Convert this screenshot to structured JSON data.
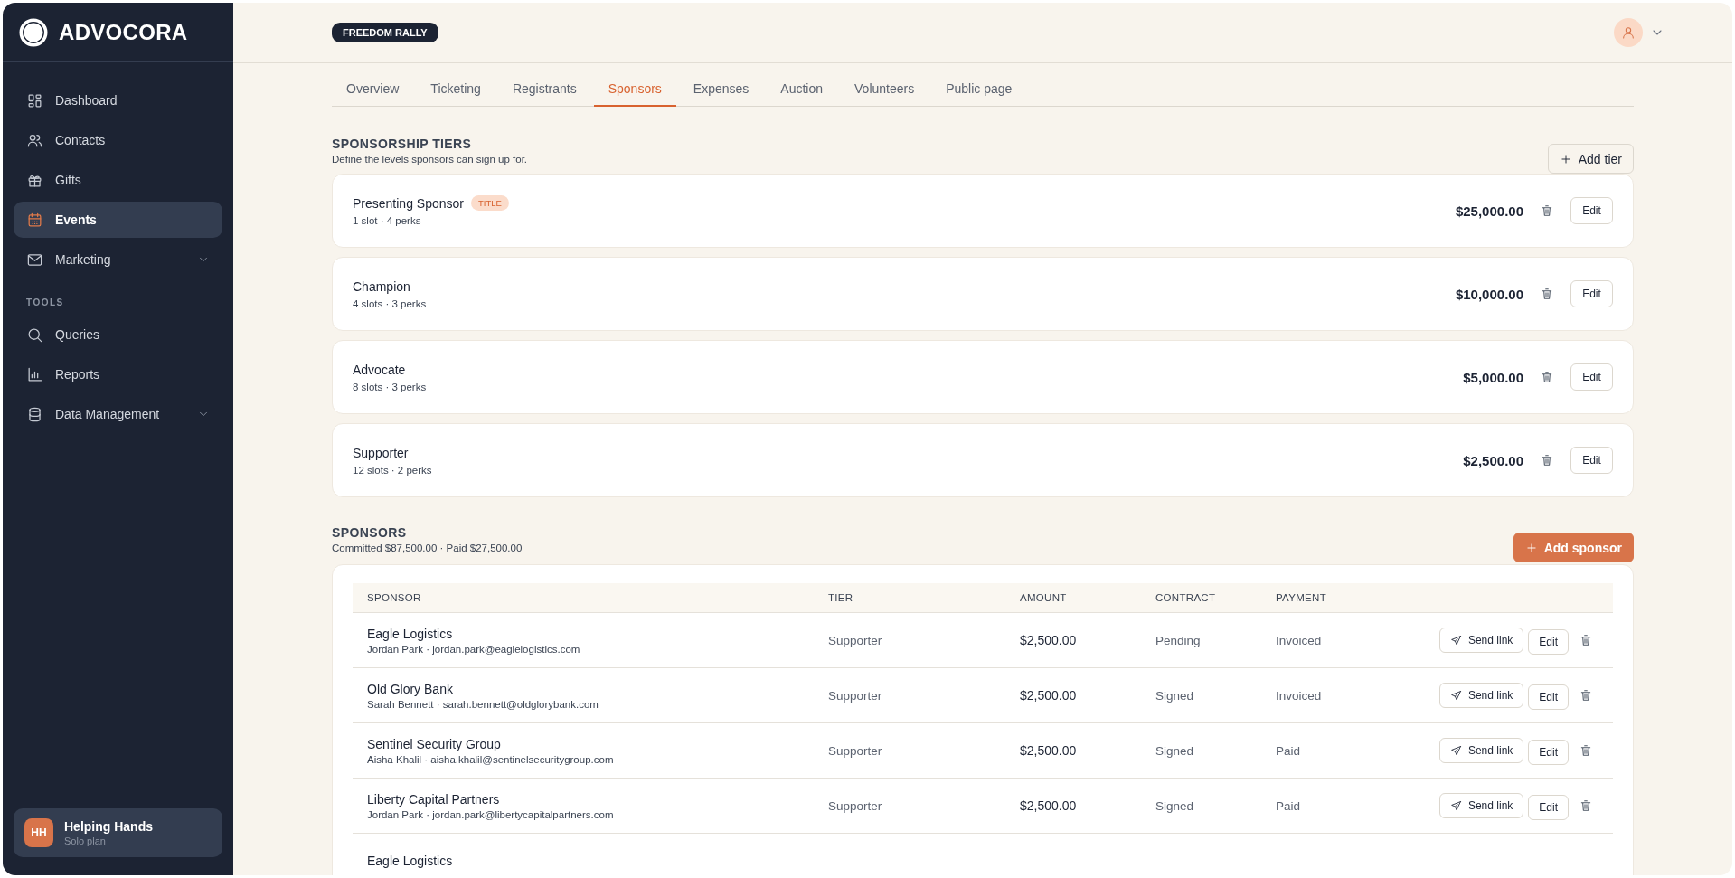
{
  "sidebar": {
    "brand": "ADVOCORA",
    "items": [
      {
        "label": "Dashboard",
        "selected": false,
        "expandable": false
      },
      {
        "label": "Contacts",
        "selected": false,
        "expandable": false
      },
      {
        "label": "Gifts",
        "selected": false,
        "expandable": false
      },
      {
        "label": "Events",
        "selected": true,
        "expandable": false
      },
      {
        "label": "Marketing",
        "selected": false,
        "expandable": true
      }
    ],
    "tools": {
      "label": "TOOLS",
      "items": [
        {
          "label": "Queries",
          "selected": false,
          "expandable": false
        },
        {
          "label": "Reports",
          "selected": false,
          "expandable": false
        },
        {
          "label": "Data Management",
          "selected": false,
          "expandable": true
        }
      ]
    },
    "org": {
      "initials": "HH",
      "name": "Helping Hands",
      "plan": "Solo plan"
    }
  },
  "header": {
    "event_badge": "FREEDOM RALLY"
  },
  "tabs": [
    {
      "label": "Overview",
      "selected": false
    },
    {
      "label": "Ticketing",
      "selected": false
    },
    {
      "label": "Registrants",
      "selected": false
    },
    {
      "label": "Sponsors",
      "selected": true
    },
    {
      "label": "Expenses",
      "selected": false
    },
    {
      "label": "Auction",
      "selected": false
    },
    {
      "label": "Volunteers",
      "selected": false
    },
    {
      "label": "Public page",
      "selected": false
    }
  ],
  "tiers_section": {
    "title": "SPONSORSHIP TIERS",
    "subtitle": "Define the levels sponsors can sign up for.",
    "add_button": "Add tier",
    "tiers": [
      {
        "name": "Presenting Sponsor",
        "badge": "TITLE",
        "details": "1 slot · 4 perks",
        "amount": "$25,000.00",
        "edit_label": "Edit"
      },
      {
        "name": "Champion",
        "details": "4 slots · 3 perks",
        "amount": "$10,000.00",
        "edit_label": "Edit"
      },
      {
        "name": "Advocate",
        "details": "8 slots · 3 perks",
        "amount": "$5,000.00",
        "edit_label": "Edit"
      },
      {
        "name": "Supporter",
        "details": "12 slots · 2 perks",
        "amount": "$2,500.00",
        "edit_label": "Edit"
      }
    ]
  },
  "sponsors_section": {
    "title": "SPONSORS",
    "summary": "Committed $87,500.00 · Paid $27,500.00",
    "add_button": "Add sponsor",
    "table": {
      "columns": [
        "SPONSOR",
        "TIER",
        "AMOUNT",
        "CONTRACT",
        "PAYMENT"
      ],
      "rows": [
        {
          "sponsor": "Eagle Logistics",
          "contact": "Jordan Park · jordan.park@eaglelogistics.com",
          "tier": "Supporter",
          "amount": "$2,500.00",
          "contract": "Pending",
          "payment": "Invoiced",
          "send_label": "Send link",
          "edit_label": "Edit"
        },
        {
          "sponsor": "Old Glory Bank",
          "contact": "Sarah Bennett · sarah.bennett@oldglorybank.com",
          "tier": "Supporter",
          "amount": "$2,500.00",
          "contract": "Signed",
          "payment": "Invoiced",
          "send_label": "Send link",
          "edit_label": "Edit"
        },
        {
          "sponsor": "Sentinel Security Group",
          "contact": "Aisha Khalil · aisha.khalil@sentinelsecuritygroup.com",
          "tier": "Supporter",
          "amount": "$2,500.00",
          "contract": "Signed",
          "payment": "Paid",
          "send_label": "Send link",
          "edit_label": "Edit"
        },
        {
          "sponsor": "Liberty Capital Partners",
          "contact": "Jordan Park · jordan.park@libertycapitalpartners.com",
          "tier": "Supporter",
          "amount": "$2,500.00",
          "contract": "Signed",
          "payment": "Paid",
          "send_label": "Send link",
          "edit_label": "Edit"
        },
        {
          "sponsor": "Eagle Logistics"
        }
      ]
    }
  }
}
